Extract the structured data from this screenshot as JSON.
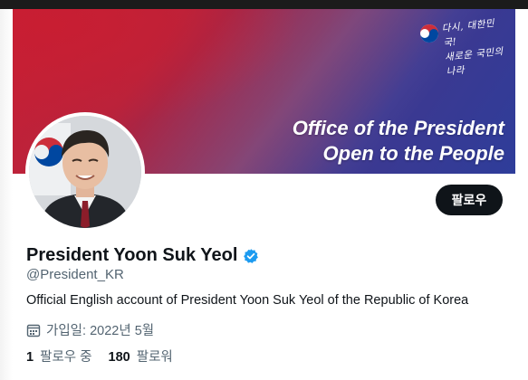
{
  "banner": {
    "title_line1": "Office of the President",
    "title_line2": "Open to the People",
    "logo_script_line1": "다시, 대한민국!",
    "logo_script_line2": "새로운 국민의 나라"
  },
  "profile": {
    "display_name": "President Yoon Suk Yeol",
    "handle": "@President_KR",
    "bio": "Official English account of President Yoon Suk Yeol of the Republic of Korea",
    "joined": "가입일: 2022년 5월",
    "verified": true
  },
  "actions": {
    "follow_label": "팔로우"
  },
  "stats": {
    "following_count": "1",
    "following_label": "팔로우 중",
    "followers_count": "180",
    "followers_label": "팔로워"
  },
  "colors": {
    "verified_blue": "#1d9bf0",
    "follow_button_bg": "#0f1419",
    "secondary_text": "#536471",
    "banner_red": "#c71f35",
    "banner_blue": "#2e3d9a"
  },
  "icons": {
    "verified": "verified-badge-icon",
    "calendar": "calendar-icon"
  }
}
